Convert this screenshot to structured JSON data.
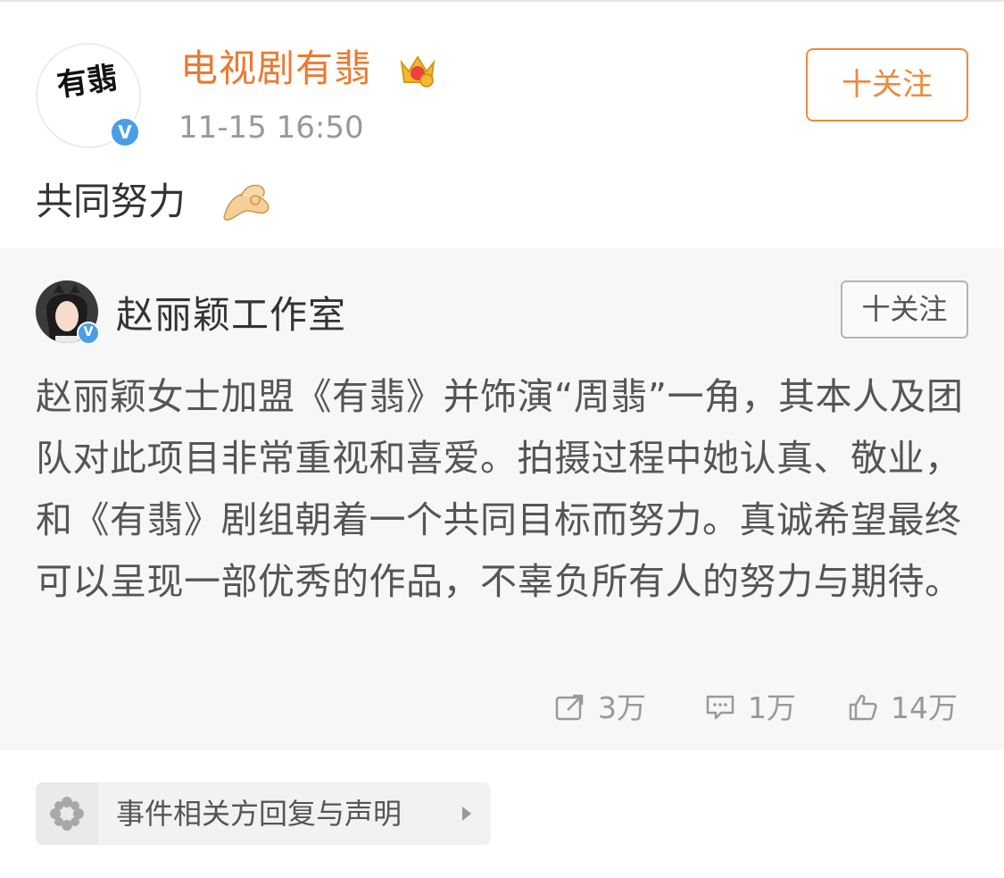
{
  "post": {
    "author_name": "电视剧有翡",
    "author_avatar_text": "有翡",
    "timestamp": "11-15 16:50",
    "follow_label": "十关注",
    "text": "共同努力",
    "icons": {
      "crown": "crown-icon",
      "verified": "verified-v-icon",
      "emoji": "ok-hands-emoji"
    },
    "colors": {
      "name": "#eb7a31",
      "follow": "#ee8a3c",
      "verified": "#4a9ee8"
    }
  },
  "retweet": {
    "author_name": "赵丽颖工作室",
    "follow_label": "十关注",
    "text": "赵丽颖女士加盟《有翡》并饰演“周翡”一角，其本人及团队对此项目非常重视和喜爱。拍摄过程中她认真、敬业，和《有翡》剧组朝着一个共同目标而努力。真诚希望最终可以呈现一部优秀的作品，不辜负所有人的努力与期待。",
    "stats": {
      "reposts": "3万",
      "comments": "1万",
      "likes": "14万"
    },
    "background": "#f7f7f7"
  },
  "topic": {
    "label": "事件相关方回复与声明",
    "icon": "flower-icon"
  }
}
